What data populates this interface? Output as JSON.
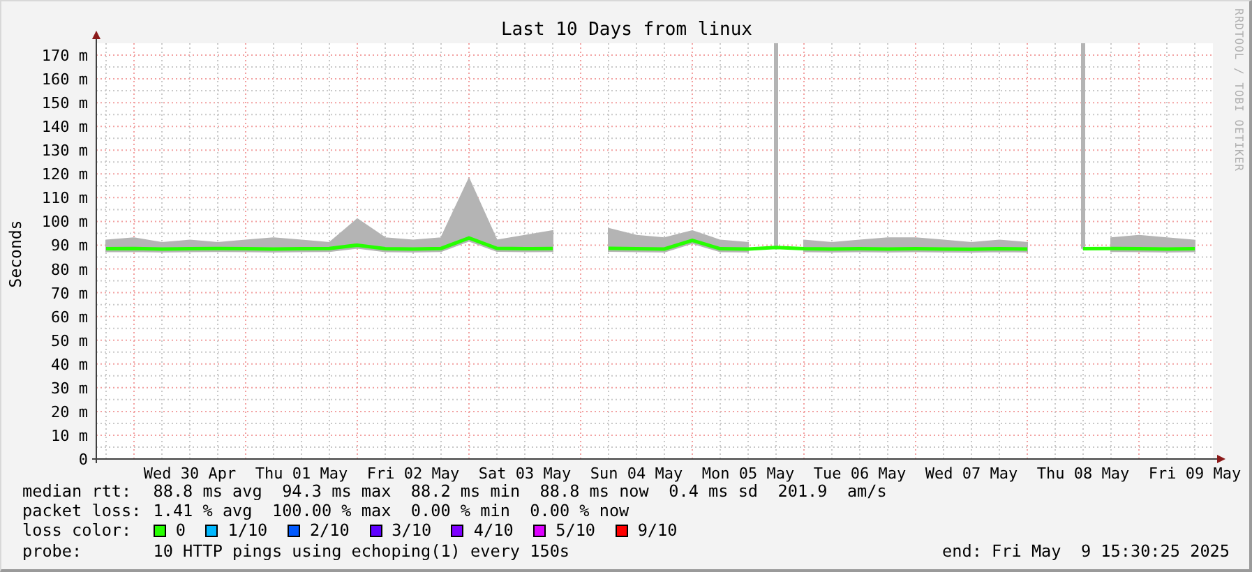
{
  "chart": {
    "chart_data": {
      "type": "line",
      "title": "Last 10 Days from linux",
      "ylabel": "Seconds",
      "ylim": [
        0,
        175
      ],
      "grid": true,
      "yticks": [
        {
          "value": 0,
          "label": "0"
        },
        {
          "value": 10,
          "label": "10 m"
        },
        {
          "value": 20,
          "label": "20 m"
        },
        {
          "value": 30,
          "label": "30 m"
        },
        {
          "value": 40,
          "label": "40 m"
        },
        {
          "value": 50,
          "label": "50 m"
        },
        {
          "value": 60,
          "label": "60 m"
        },
        {
          "value": 70,
          "label": "70 m"
        },
        {
          "value": 80,
          "label": "80 m"
        },
        {
          "value": 90,
          "label": "90 m"
        },
        {
          "value": 100,
          "label": "100 m"
        },
        {
          "value": 110,
          "label": "110 m"
        },
        {
          "value": 120,
          "label": "120 m"
        },
        {
          "value": 130,
          "label": "130 m"
        },
        {
          "value": 140,
          "label": "140 m"
        },
        {
          "value": 150,
          "label": "150 m"
        },
        {
          "value": 160,
          "label": "160 m"
        },
        {
          "value": 170,
          "label": "170 m"
        }
      ],
      "categories": [
        null,
        null,
        null,
        "Wed 30 Apr",
        null,
        null,
        null,
        "Thu 01 May",
        null,
        null,
        null,
        "Fri 02 May",
        null,
        null,
        null,
        "Sat 03 May",
        null,
        null,
        null,
        "Sun 04 May",
        null,
        null,
        null,
        "Mon 05 May",
        null,
        null,
        null,
        "Tue 06 May",
        null,
        null,
        null,
        "Wed 07 May",
        null,
        null,
        null,
        "Thu 08 May",
        null,
        null,
        null,
        "Fri 09 May"
      ],
      "series": [
        {
          "type": "area",
          "color": "#b4b4b4",
          "values": [
            92,
            93,
            91,
            92,
            91,
            92,
            93,
            92,
            91,
            101,
            93,
            92,
            93,
            118,
            92,
            94,
            96,
            null,
            97,
            94,
            93,
            96,
            92,
            91,
            null,
            92,
            91,
            92,
            93,
            93,
            92,
            91,
            92,
            91,
            null,
            null,
            93,
            94,
            93,
            92
          ]
        },
        {
          "type": "line",
          "color": "#26ff00",
          "values": [
            88.5,
            88.6,
            88.4,
            88.5,
            88.6,
            88.5,
            88.4,
            88.5,
            88.6,
            90,
            88.5,
            88.4,
            88.6,
            93,
            88.7,
            88.5,
            88.6,
            null,
            88.7,
            88.5,
            88.4,
            92,
            88.5,
            88.4,
            89,
            88.5,
            88.4,
            88.5,
            88.4,
            88.5,
            88.4,
            88.3,
            88.5,
            88.4,
            null,
            88.5,
            88.6,
            88.5,
            88.4,
            88.5
          ]
        }
      ]
    }
  },
  "watermark_text": "RRDTOOL / TOBI OETIKER",
  "stats": [
    {
      "label": "median rtt:",
      "values": [
        "88.8 ms avg",
        "94.3 ms max",
        "88.2 ms min",
        "88.8 ms now",
        "0.4 ms sd",
        "201.9",
        "am/s"
      ]
    },
    {
      "label": "packet loss:",
      "values": [
        "1.41 % avg",
        "100.00 % max",
        "0.00 % min",
        "0.00 % now"
      ]
    }
  ],
  "loss_color": {
    "label": "loss color:",
    "items": [
      {
        "label": "0",
        "color": "#26ff00"
      },
      {
        "label": "1/10",
        "color": "#00b8ff"
      },
      {
        "label": "2/10",
        "color": "#0059ff"
      },
      {
        "label": "3/10",
        "color": "#5e00ff"
      },
      {
        "label": "4/10",
        "color": "#7e00ff"
      },
      {
        "label": "5/10",
        "color": "#dd00ff"
      },
      {
        "label": "9/10",
        "color": "#ff0000"
      }
    ]
  },
  "probe": {
    "label": "probe:",
    "text": "10 HTTP pings using echoping(1) every 150s"
  },
  "end": "end: Fri May  9 15:30:25 2025"
}
